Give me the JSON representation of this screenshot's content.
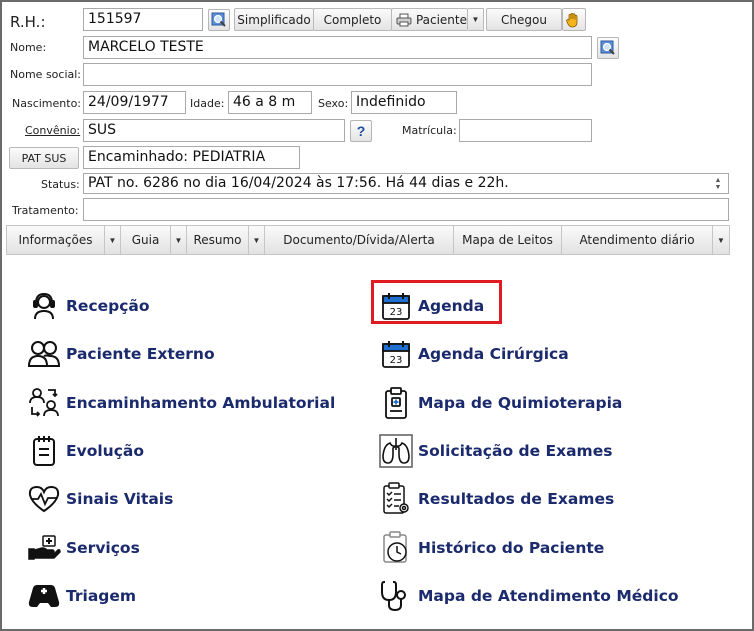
{
  "header": {
    "rh": {
      "label": "R.H.:",
      "value": "151597"
    },
    "buttons": {
      "simplificado": "Simplificado",
      "completo": "Completo",
      "paciente": "Paciente",
      "chegou": "Chegou"
    },
    "nome": {
      "label": "Nome:",
      "value": "MARCELO TESTE"
    },
    "nome_social": {
      "label": "Nome social:",
      "value": ""
    },
    "nascimento": {
      "label": "Nascimento:",
      "value": "24/09/1977"
    },
    "idade": {
      "label": "Idade:",
      "value": "46 a 8 m"
    },
    "sexo": {
      "label": "Sexo:",
      "value": "Indefinido"
    },
    "convenio": {
      "label": "Convênio:",
      "value": "SUS",
      "help": "?"
    },
    "matricula": {
      "label": "Matrícula:",
      "value": ""
    },
    "pat_sus": {
      "label": "PAT SUS",
      "value": "Encaminhado: PEDIATRIA"
    },
    "status": {
      "label": "Status:",
      "value": "PAT no. 6286 no dia 16/04/2024  às  17:56. Há 44 dias e 22h."
    },
    "tratamento": {
      "label": "Tratamento:",
      "value": ""
    }
  },
  "tabs": [
    {
      "label": "Informações",
      "dropdown": true
    },
    {
      "label": "Guia",
      "dropdown": true
    },
    {
      "label": "Resumo",
      "dropdown": true
    },
    {
      "label": "Documento/Dívida/Alerta",
      "dropdown": false
    },
    {
      "label": "Mapa de Leitos",
      "dropdown": false
    },
    {
      "label": "Atendimento diário",
      "dropdown": true
    }
  ],
  "menu": {
    "left": [
      {
        "label": "Recepção",
        "icon": "headset-icon"
      },
      {
        "label": "Paciente Externo",
        "icon": "users-icon"
      },
      {
        "label": "Encaminhamento Ambulatorial",
        "icon": "referral-icon"
      },
      {
        "label": "Evolução",
        "icon": "notes-icon"
      },
      {
        "label": "Sinais Vitais",
        "icon": "heartbeat-icon"
      },
      {
        "label": "Serviços",
        "icon": "hand-service-icon"
      },
      {
        "label": "Triagem",
        "icon": "triage-icon"
      }
    ],
    "right": [
      {
        "label": "Agenda",
        "icon": "calendar-icon",
        "highlighted": true
      },
      {
        "label": "Agenda Cirúrgica",
        "icon": "calendar-icon"
      },
      {
        "label": "Mapa de Quimioterapia",
        "icon": "clipboard-medical-icon"
      },
      {
        "label": "Solicitação de Exames",
        "icon": "lungs-icon"
      },
      {
        "label": "Resultados de Exames",
        "icon": "checklist-icon"
      },
      {
        "label": "Histórico do Paciente",
        "icon": "history-icon"
      },
      {
        "label": "Mapa de Atendimento Médico",
        "icon": "stethoscope-icon"
      }
    ],
    "calendar_day": "23"
  },
  "colors": {
    "menu_text": "#1a2a6c",
    "icon_blue": "#1f6fd1",
    "highlight": "#e11b22"
  }
}
